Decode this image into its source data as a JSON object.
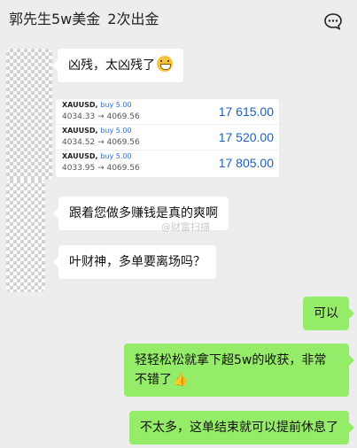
{
  "header": {
    "title": "郭先生5w美金",
    "title_suffix": "2次出金",
    "menu_icon": "chat-bubble-dots-icon"
  },
  "messages": [
    {
      "side": "left",
      "text": "凶残，太凶残了",
      "emoji": "grinning-face-emoji"
    },
    {
      "side": "left",
      "text": "跟着您做多赚钱是真的爽啊"
    },
    {
      "side": "left",
      "text": "叶财神，多单要离场吗？"
    },
    {
      "side": "right",
      "text": "可以"
    },
    {
      "side": "right",
      "text": "轻轻松松就拿下超5w的收获，非常不错了",
      "emoji": "thumbs-up-emoji"
    },
    {
      "side": "right",
      "text": "不太多，这单结束就可以提前休息了"
    }
  ],
  "trades": [
    {
      "symbol": "XAUUSD,",
      "direction": "buy 5.00",
      "prices": "4034.33 → 4069.56",
      "profit": "17 615.00"
    },
    {
      "symbol": "XAUUSD,",
      "direction": "buy 5.00",
      "prices": "4034.52 → 4069.56",
      "profit": "17 520.00"
    },
    {
      "symbol": "XAUUSD,",
      "direction": "buy 5.00",
      "prices": "4033.95 → 4069.56",
      "profit": "17 805.00"
    }
  ],
  "watermark": "@财富扫描",
  "colors": {
    "background": "#ededed",
    "bubble_left": "#ffffff",
    "bubble_right": "#95ec69",
    "profit": "#1f5fbf",
    "direction": "#2f6fd6"
  }
}
